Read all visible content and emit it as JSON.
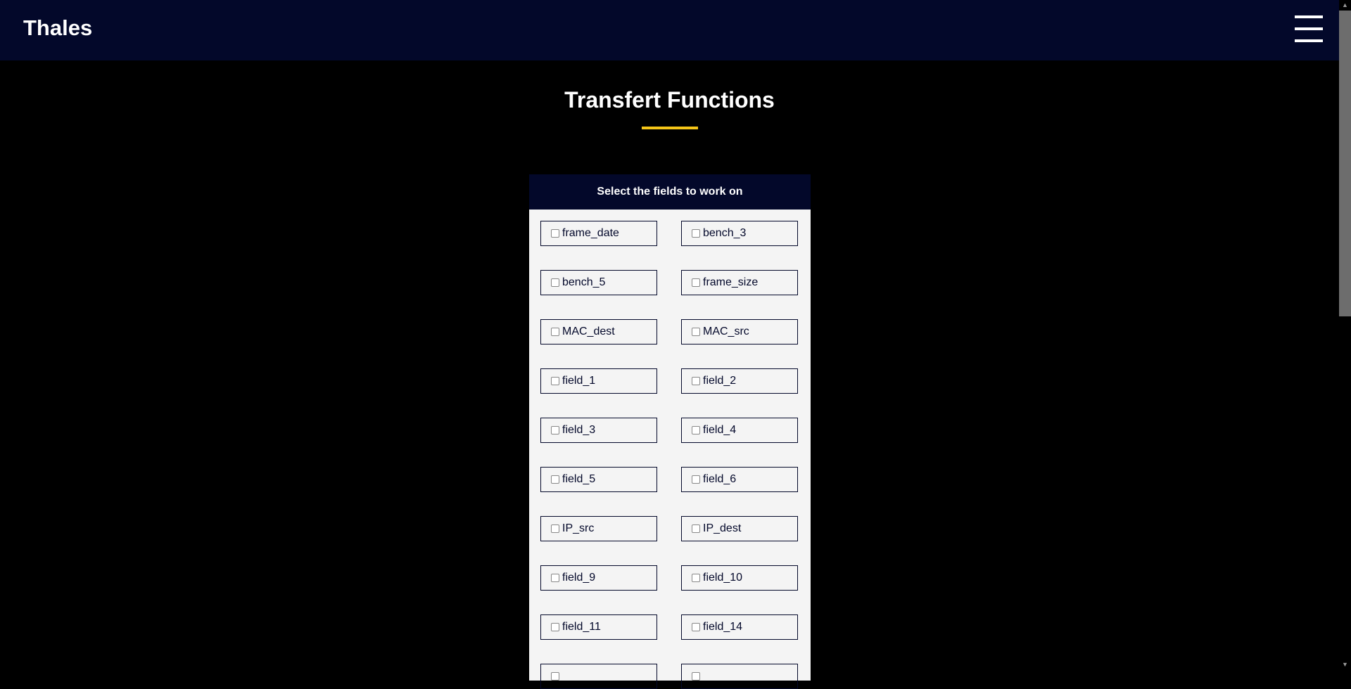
{
  "header": {
    "brand": "Thales",
    "menu_icon": "hamburger-icon"
  },
  "page": {
    "title": "Transfert Functions",
    "accent_color": "#f5c518"
  },
  "panel": {
    "heading": "Select the fields to work on",
    "fields": [
      {
        "label": "frame_date",
        "checked": false
      },
      {
        "label": "bench_3",
        "checked": false
      },
      {
        "label": "bench_5",
        "checked": false
      },
      {
        "label": "frame_size",
        "checked": false
      },
      {
        "label": "MAC_dest",
        "checked": false
      },
      {
        "label": "MAC_src",
        "checked": false
      },
      {
        "label": "field_1",
        "checked": false
      },
      {
        "label": "field_2",
        "checked": false
      },
      {
        "label": "field_3",
        "checked": false
      },
      {
        "label": "field_4",
        "checked": false
      },
      {
        "label": "field_5",
        "checked": false
      },
      {
        "label": "field_6",
        "checked": false
      },
      {
        "label": "IP_src",
        "checked": false
      },
      {
        "label": "IP_dest",
        "checked": false
      },
      {
        "label": "field_9",
        "checked": false
      },
      {
        "label": "field_10",
        "checked": false
      },
      {
        "label": "field_11",
        "checked": false
      },
      {
        "label": "field_14",
        "checked": false
      },
      {
        "label": "",
        "checked": false
      },
      {
        "label": "",
        "checked": false
      }
    ]
  }
}
